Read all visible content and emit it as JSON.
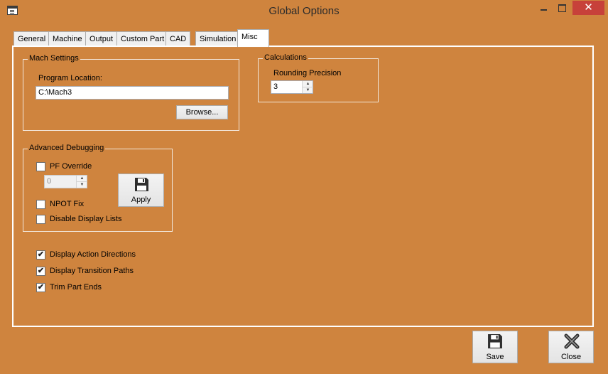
{
  "window": {
    "title": "Global Options",
    "minimize_glyph": "",
    "maximize_glyph": "",
    "close_glyph": "✕"
  },
  "tabs": [
    {
      "label": "General",
      "selected": false
    },
    {
      "label": "Machine",
      "selected": false
    },
    {
      "label": "Output",
      "selected": false
    },
    {
      "label": "Custom Part",
      "selected": false
    },
    {
      "label": "CAD",
      "selected": false
    },
    {
      "label": "Simulation",
      "selected": false
    },
    {
      "label": "Misc",
      "selected": true
    }
  ],
  "mach_settings": {
    "group_label": "Mach Settings",
    "program_location_label": "Program Location:",
    "program_location_value": "C:\\Mach3",
    "browse_label": "Browse..."
  },
  "calculations": {
    "group_label": "Calculations",
    "rounding_label": "Rounding Precision",
    "rounding_value": "3"
  },
  "advanced_debugging": {
    "group_label": "Advanced Debugging",
    "pf_override_label": "PF Override",
    "pf_override_checked": false,
    "pf_value": "0",
    "apply_label": "Apply",
    "npot_fix_label": "NPOT Fix",
    "npot_fix_checked": false,
    "disable_display_lists_label": "Disable Display Lists",
    "disable_display_lists_checked": false
  },
  "options": {
    "display_action_directions_label": "Display Action Directions",
    "display_action_directions_checked": true,
    "display_transition_paths_label": "Display Transition Paths",
    "display_transition_paths_checked": true,
    "trim_part_ends_label": "Trim Part Ends",
    "trim_part_ends_checked": true
  },
  "footer": {
    "save_label": "Save",
    "close_label": "Close"
  },
  "check_glyph": "✔",
  "colors": {
    "background": "#cf843e",
    "close_button": "#c7413a",
    "floppy": "#2f2f2f"
  }
}
